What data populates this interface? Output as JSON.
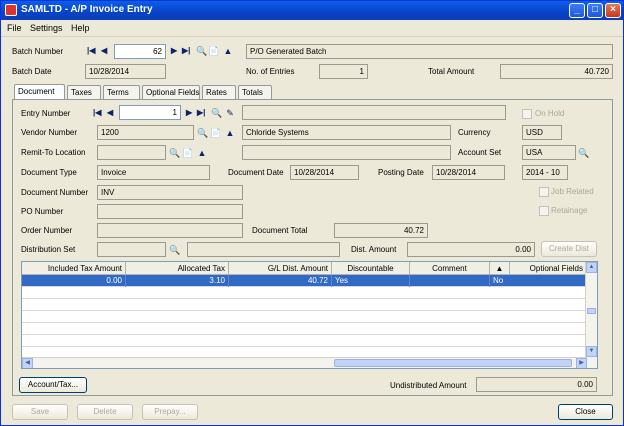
{
  "window": {
    "title": "SAMLTD - A/P Invoice Entry",
    "minimize": "_",
    "maximize": "□",
    "close": "×"
  },
  "menu": {
    "file": "File",
    "settings": "Settings",
    "help": "Help"
  },
  "batch": {
    "number_label": "Batch Number",
    "number": "62",
    "description": "P/O Generated Batch",
    "date_label": "Batch Date",
    "date": "10/28/2014",
    "entries_label": "No. of Entries",
    "entries": "1",
    "total_label": "Total Amount",
    "total": "40.720"
  },
  "tabs": [
    "Document",
    "Taxes",
    "Terms",
    "Optional Fields",
    "Rates",
    "Totals"
  ],
  "doc": {
    "entry_label": "Entry Number",
    "entry": "1",
    "entry_desc": "",
    "on_hold_label": "On Hold",
    "vendor_label": "Vendor Number",
    "vendor": "1200",
    "vendor_name": "Chloride Systems",
    "currency_label": "Currency",
    "currency": "USD",
    "remit_label": "Remit-To Location",
    "remit": "",
    "remit_name": "",
    "account_set_label": "Account Set",
    "account_set": "USA",
    "doc_type_label": "Document Type",
    "doc_type": "Invoice",
    "doc_date_label": "Document Date",
    "doc_date": "10/28/2014",
    "posting_date_label": "Posting Date",
    "posting_date": "10/28/2014",
    "period": "2014 - 10",
    "doc_number_label": "Document Number",
    "doc_number": "INV",
    "job_related_label": "Job Related",
    "po_label": "PO Number",
    "po": "",
    "retainage_label": "Retainage",
    "order_label": "Order Number",
    "order": "",
    "doc_total_label": "Document Total",
    "doc_total": "40.72",
    "dist_set_label": "Distribution Set",
    "dist_set": "",
    "dist_set_desc": "",
    "dist_amount_label": "Dist. Amount",
    "dist_amount": "0.00",
    "create_dist": "Create Dist"
  },
  "grid": {
    "columns": [
      "Included Tax Amount",
      "Allocated Tax",
      "G/L Dist. Amount",
      "Discountable",
      "Comment",
      "",
      "Optional Fields"
    ],
    "rows": [
      [
        "0.00",
        "3.10",
        "40.72",
        "Yes",
        "",
        "",
        "No"
      ]
    ]
  },
  "footer": {
    "account_tax": "Account/Tax...",
    "undistributed_label": "Undistributed Amount",
    "undistributed": "0.00",
    "save": "Save",
    "delete": "Delete",
    "prepay": "Prepay...",
    "close": "Close"
  }
}
